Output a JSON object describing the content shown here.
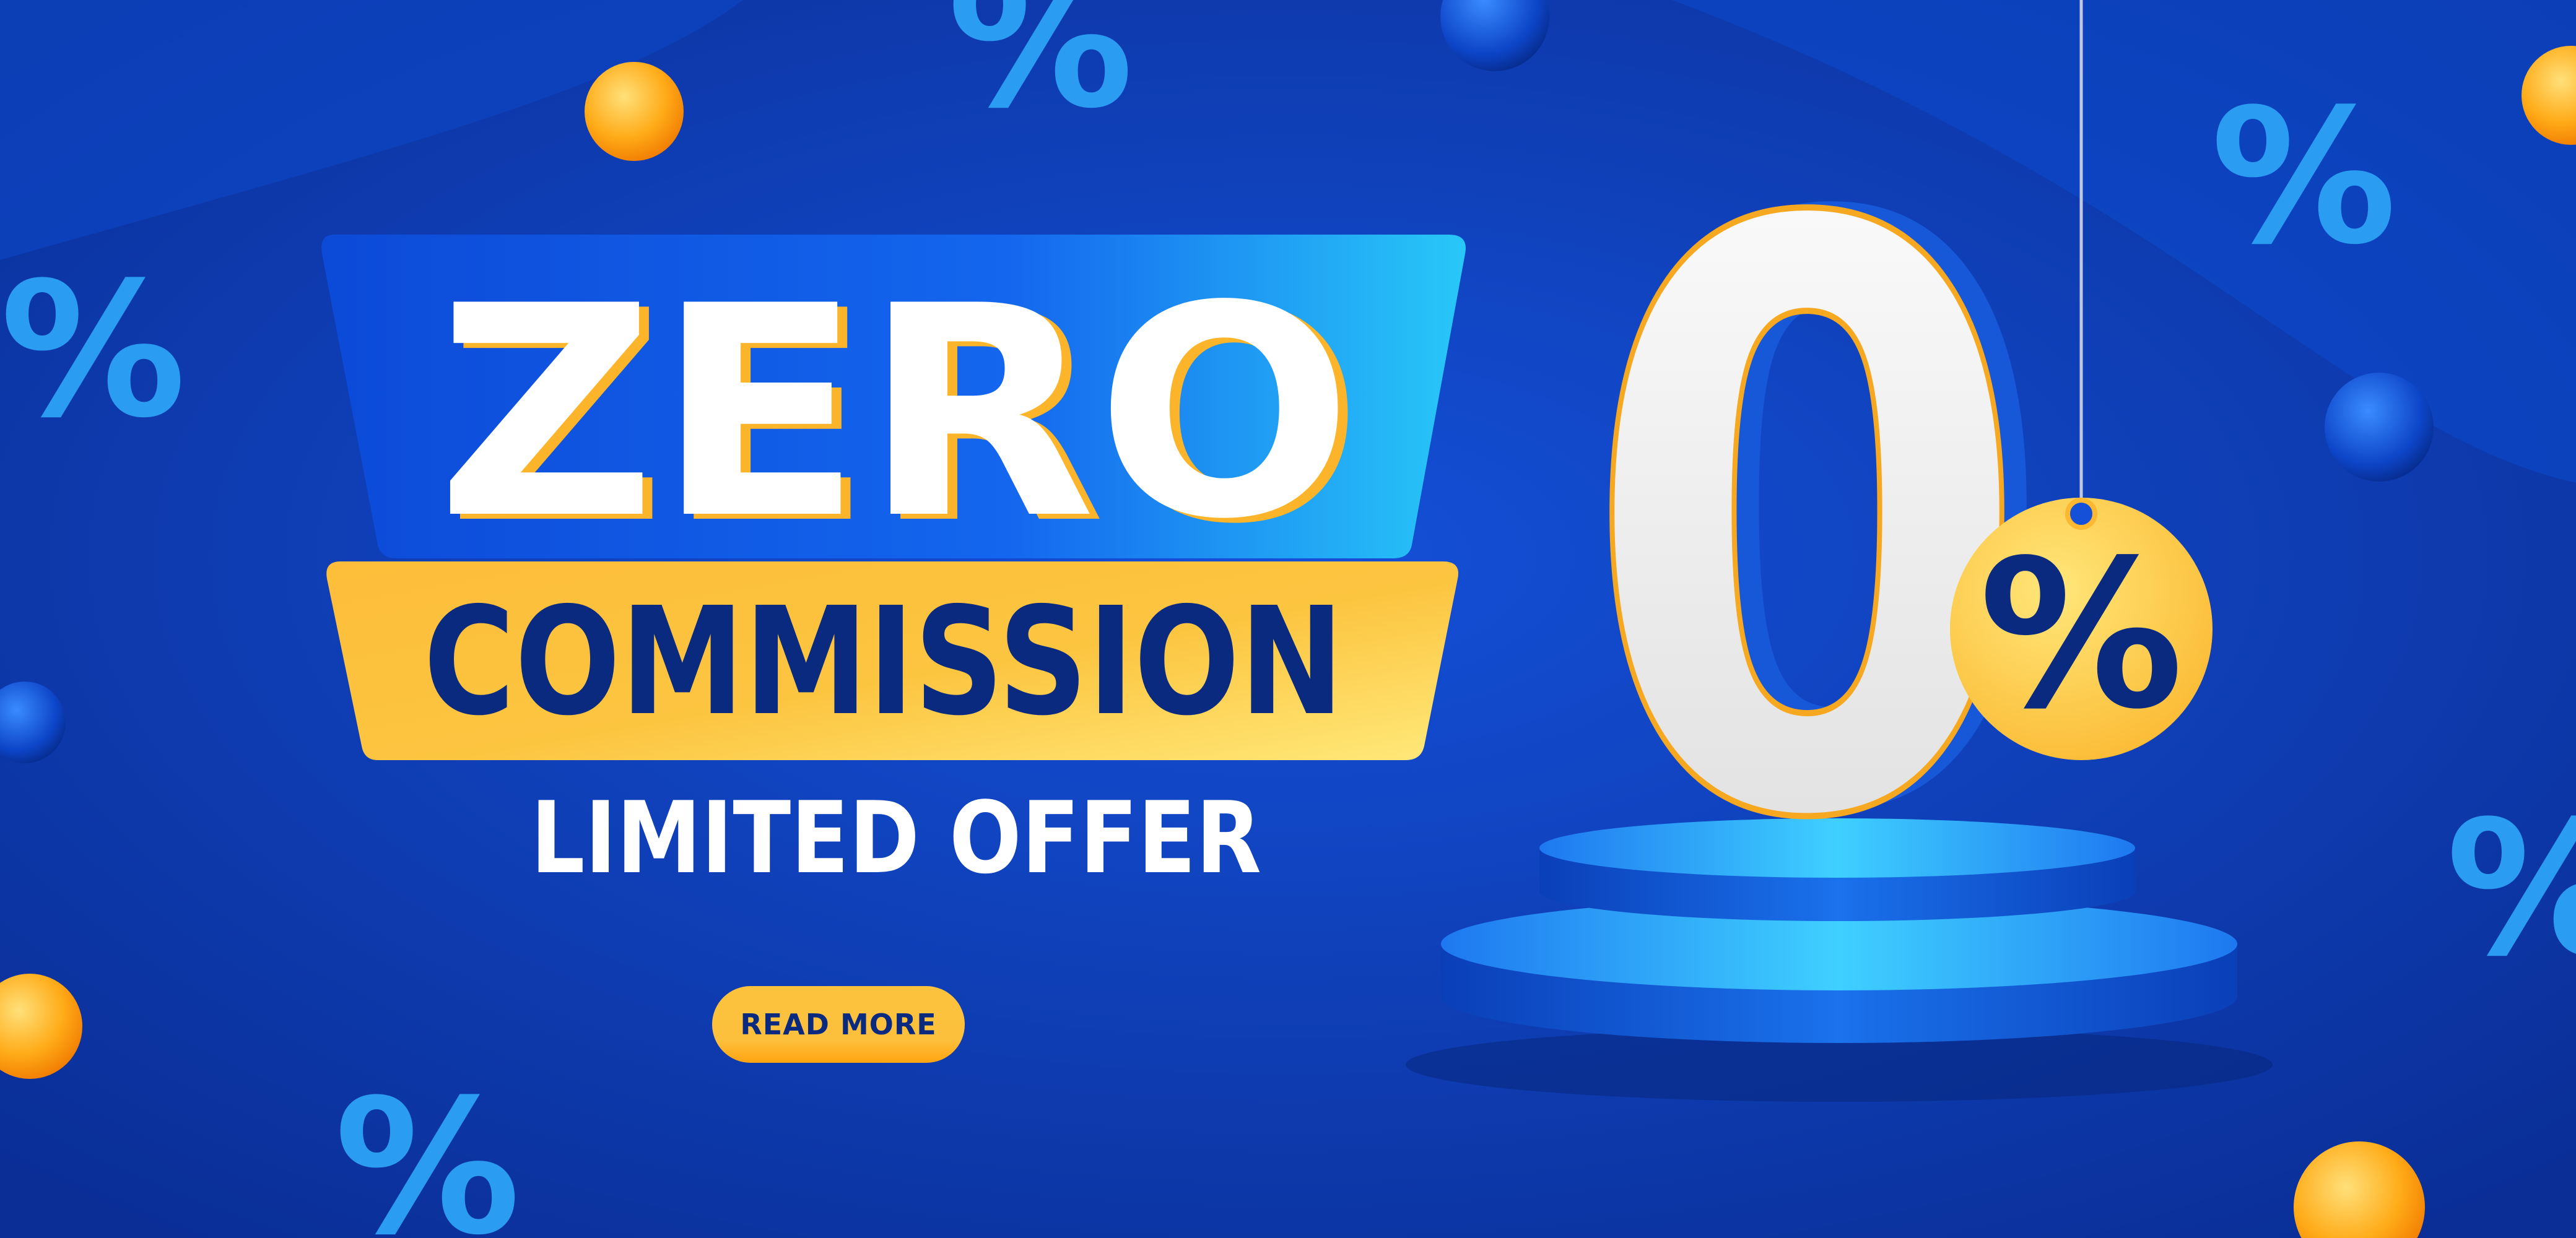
{
  "banner": {
    "headline": "ZERO",
    "subheadline": "COMMISSION",
    "tagline": "LIMITED OFFER",
    "big_digit": "0",
    "tag_symbol": "%",
    "decor_symbol": "%",
    "cta_label": "READ MORE"
  },
  "colors": {
    "background": "#0a3aa8",
    "accent_yellow": "#fcc23e",
    "accent_orange": "#ffa412",
    "text_dark": "#0a2a80",
    "highlight_cyan": "#3fd0ff"
  }
}
